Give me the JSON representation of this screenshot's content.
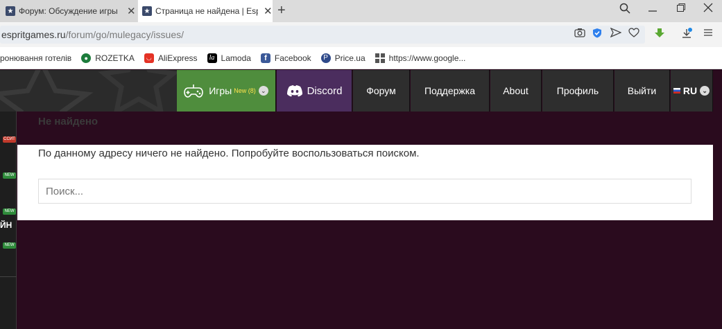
{
  "browser": {
    "tabs": [
      {
        "title": "Форум: Обсуждение игры",
        "active": false
      },
      {
        "title": "Страница не найдена | Esp",
        "active": true
      }
    ],
    "url_host": "espritgames.ru",
    "url_path": "/forum/go/mulegacy/issues/",
    "bookmarks": [
      {
        "label": "ронювання готелів",
        "icon": "hotel-icon"
      },
      {
        "label": "ROZETKA",
        "icon": "rozetka-icon",
        "color": "#1c7c3b"
      },
      {
        "label": "AliExpress",
        "icon": "aliexpress-icon",
        "color": "#e43225"
      },
      {
        "label": "Lamoda",
        "icon": "lamoda-icon",
        "color": "#000000"
      },
      {
        "label": "Facebook",
        "icon": "facebook-icon",
        "color": "#3b5998"
      },
      {
        "label": "Price.ua",
        "icon": "price-icon",
        "color": "#2f4a8a"
      },
      {
        "label": "https://www.google...",
        "icon": "apps-icon",
        "color": "#555555"
      }
    ]
  },
  "site": {
    "nav": {
      "games_label": "Игры",
      "games_badge": "New (8)",
      "discord_label": "Discord",
      "forum_label": "Форум",
      "support_label": "Поддержка",
      "about_label": "About",
      "profile_label": "Профиль",
      "logout_label": "Выйти",
      "lang_label": "RU"
    },
    "left_badges": [
      "ССИТ",
      "NEW",
      "NEW",
      "NEW"
    ],
    "left_text": "ЙН",
    "page_title": "Не найдено",
    "message": "По данному адресу ничего не найдено. Попробуйте воспользоваться поиском.",
    "search_placeholder": "Поиск...",
    "colors": {
      "games_bg": "#4f8d3d",
      "discord_bg": "#4b2d5e",
      "nav_bg": "#2e2e2e",
      "page_bg": "#2a0b1e",
      "badge_new": "#2e8b3a",
      "badge_hot": "#c0392b"
    }
  }
}
